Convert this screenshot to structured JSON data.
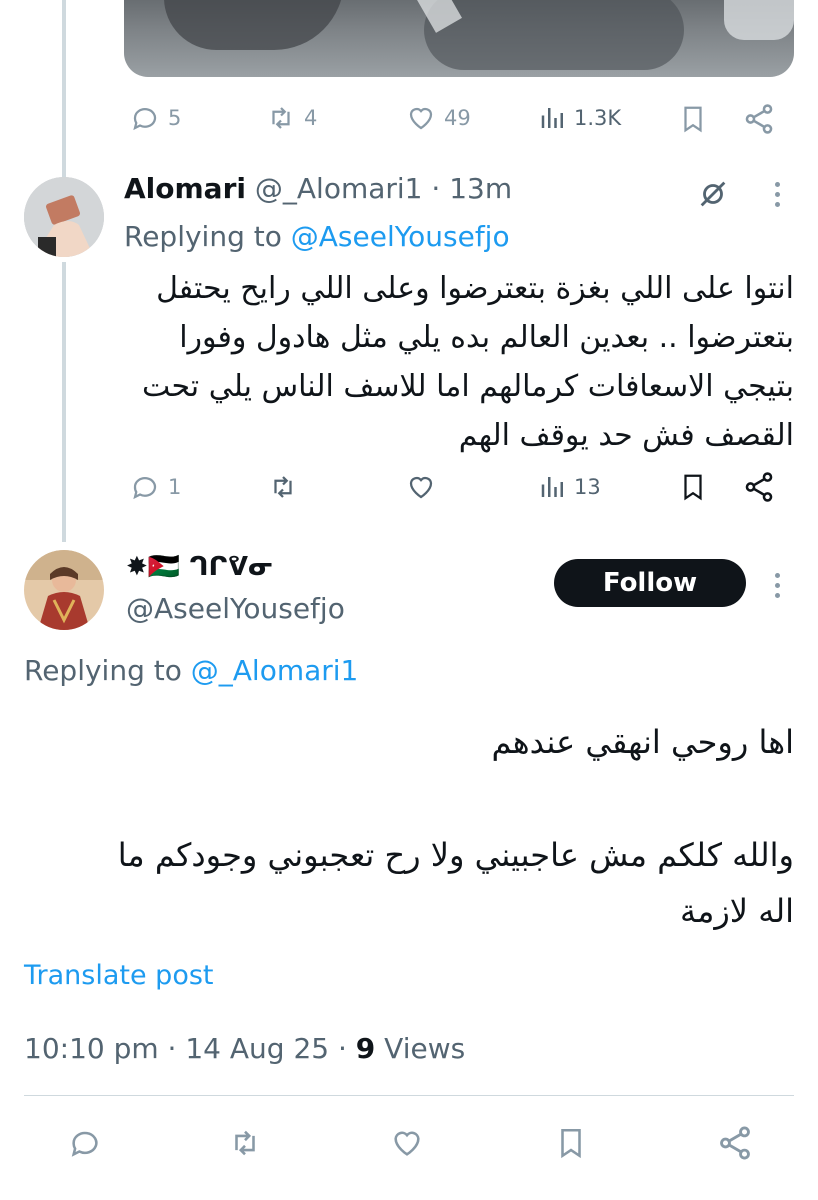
{
  "prev_tweet": {
    "actions": {
      "replies": "5",
      "reposts": "4",
      "likes": "49",
      "views": "1.3K"
    }
  },
  "reply_tweet": {
    "display_name": "Alomari",
    "handle": "@_Alomari1",
    "separator": "·",
    "time": "13m",
    "replying_prefix": "Replying to",
    "replying_handle": "@AseelYousefjo",
    "text_lines": [
      "انتوا على اللي بغزة بتعترضوا وعلى اللي رايح يحتفل",
      "بتعترضوا .. بعدين العالم بده يلي مثل هادول وفورا",
      "بتيجي الاسعافات كرمالهم اما للاسف الناس يلي تحت",
      "القصف فش حد يوقف الهم"
    ],
    "actions": {
      "replies": "1",
      "views": "13"
    }
  },
  "main_tweet": {
    "display_name": "✸🇯🇴 ᒉᒋᕓᓂ",
    "handle": "@AseelYousefjo",
    "follow_label": "Follow",
    "replying_prefix": "Replying to",
    "replying_handle": "@_Alomari1",
    "text_line_1": "اها روحي انهقي عندهم",
    "text_line_2": "والله كلكم مش عاجبيني ولا رح تعجبوني وجودكم ما",
    "text_line_3": "اله لازمة",
    "translate_label": "Translate post",
    "timestamp": "10:10 pm · 14 Aug 25 · ",
    "views_count": "9",
    "views_label": " Views"
  },
  "colors": {
    "accent": "#1d9bf0",
    "text": "#0f1419",
    "muted": "#536471",
    "icon": "#8899a6",
    "divider": "#cfd9de"
  }
}
